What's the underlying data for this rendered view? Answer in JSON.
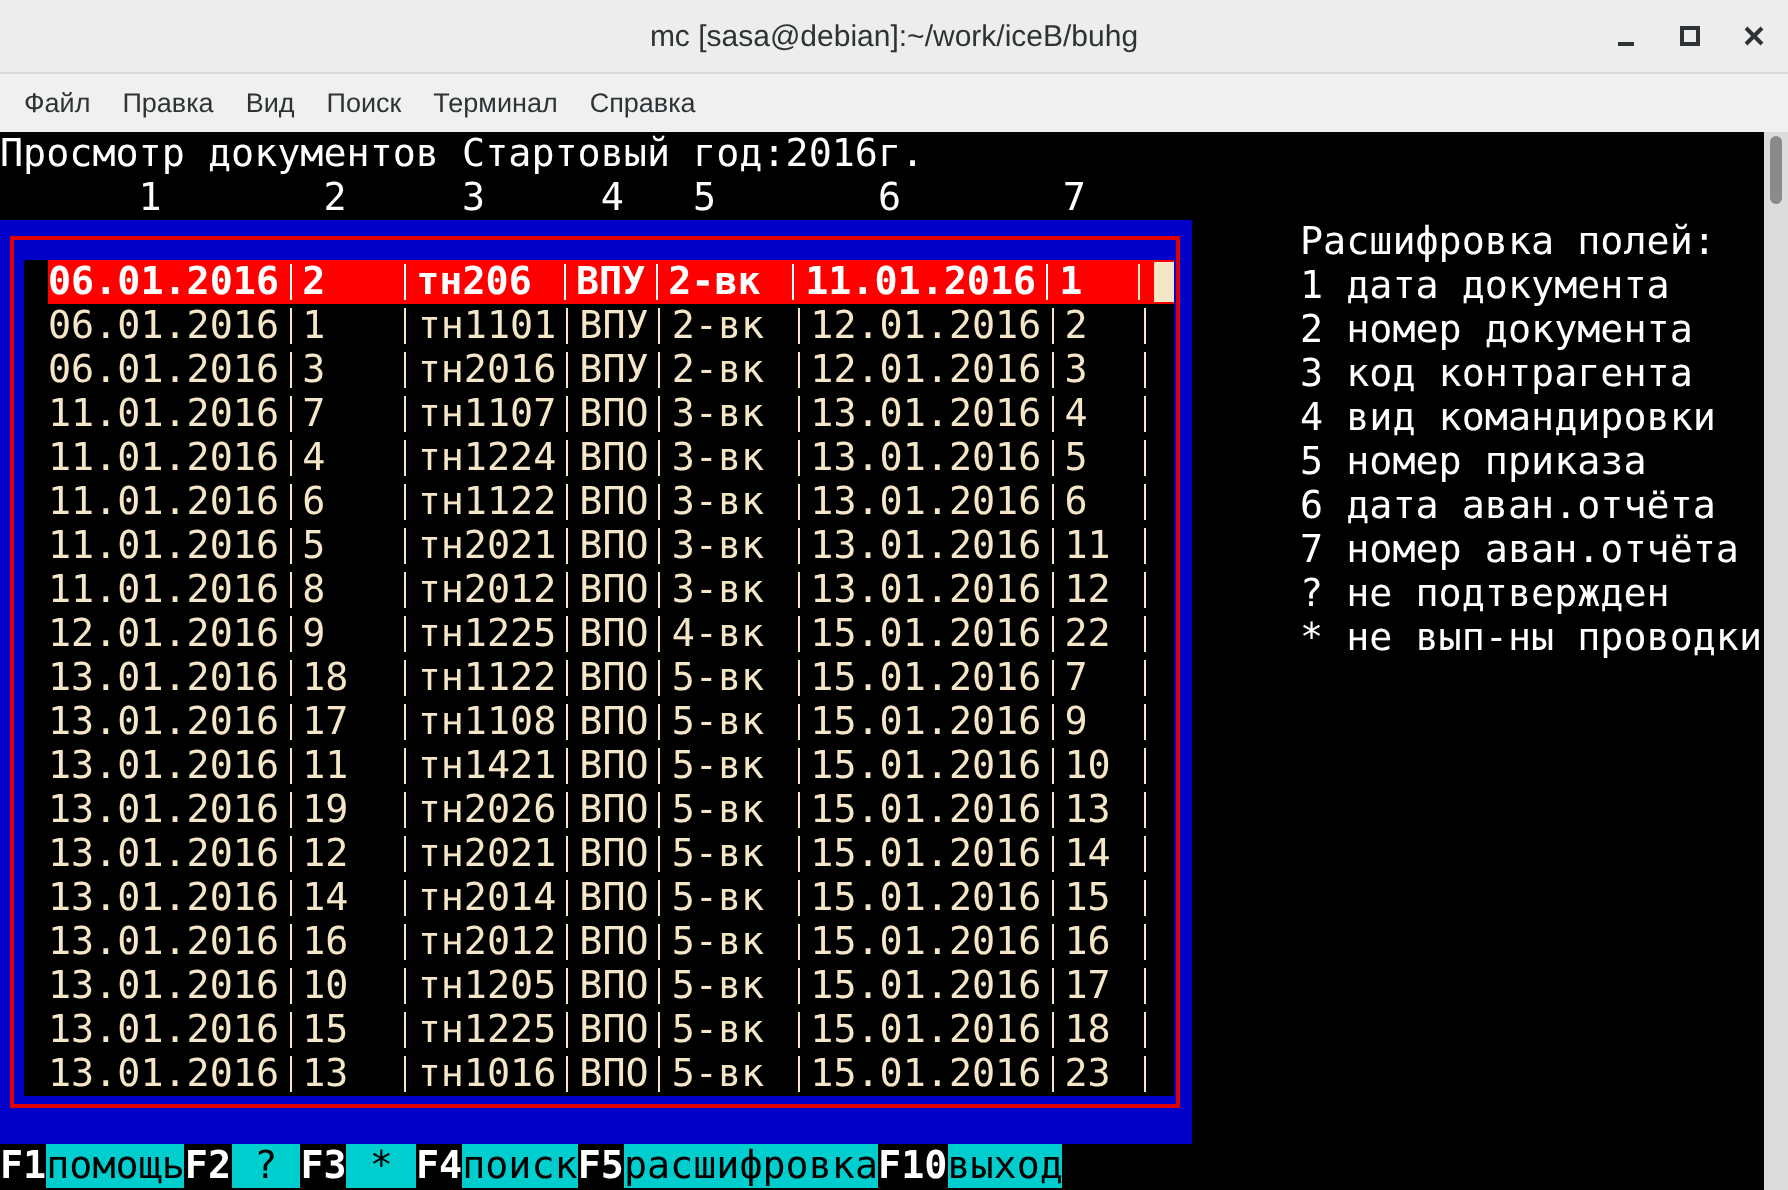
{
  "window": {
    "title": "mc [sasa@debian]:~/work/iceB/buhg"
  },
  "menu": [
    "Файл",
    "Правка",
    "Вид",
    "Поиск",
    "Терминал",
    "Справка"
  ],
  "terminal": {
    "heading": "Просмотр документов Стартовый год:2016г.",
    "column_numbers": "      1       2     3     4   5       6       7",
    "rows": [
      {
        "date": "06.01.2016",
        "number": "2",
        "code": "тн206",
        "kind": "ВПУ",
        "order": "2-вк",
        "report_date": "11.01.2016",
        "report_number": "1",
        "selected": true
      },
      {
        "date": "06.01.2016",
        "number": "1",
        "code": "тн1101",
        "kind": "ВПУ",
        "order": "2-вк",
        "report_date": "12.01.2016",
        "report_number": "2",
        "selected": false
      },
      {
        "date": "06.01.2016",
        "number": "3",
        "code": "тн2016",
        "kind": "ВПУ",
        "order": "2-вк",
        "report_date": "12.01.2016",
        "report_number": "3",
        "selected": false
      },
      {
        "date": "11.01.2016",
        "number": "7",
        "code": "тн1107",
        "kind": "ВПО",
        "order": "3-вк",
        "report_date": "13.01.2016",
        "report_number": "4",
        "selected": false
      },
      {
        "date": "11.01.2016",
        "number": "4",
        "code": "тн1224",
        "kind": "ВПО",
        "order": "3-вк",
        "report_date": "13.01.2016",
        "report_number": "5",
        "selected": false
      },
      {
        "date": "11.01.2016",
        "number": "6",
        "code": "тн1122",
        "kind": "ВПО",
        "order": "3-вк",
        "report_date": "13.01.2016",
        "report_number": "6",
        "selected": false
      },
      {
        "date": "11.01.2016",
        "number": "5",
        "code": "тн2021",
        "kind": "ВПО",
        "order": "3-вк",
        "report_date": "13.01.2016",
        "report_number": "11",
        "selected": false
      },
      {
        "date": "11.01.2016",
        "number": "8",
        "code": "тн2012",
        "kind": "ВПО",
        "order": "3-вк",
        "report_date": "13.01.2016",
        "report_number": "12",
        "selected": false
      },
      {
        "date": "12.01.2016",
        "number": "9",
        "code": "тн1225",
        "kind": "ВПО",
        "order": "4-вк",
        "report_date": "15.01.2016",
        "report_number": "22",
        "selected": false
      },
      {
        "date": "13.01.2016",
        "number": "18",
        "code": "тн1122",
        "kind": "ВПО",
        "order": "5-вк",
        "report_date": "15.01.2016",
        "report_number": "7",
        "selected": false
      },
      {
        "date": "13.01.2016",
        "number": "17",
        "code": "тн1108",
        "kind": "ВПО",
        "order": "5-вк",
        "report_date": "15.01.2016",
        "report_number": "9",
        "selected": false
      },
      {
        "date": "13.01.2016",
        "number": "11",
        "code": "тн1421",
        "kind": "ВПО",
        "order": "5-вк",
        "report_date": "15.01.2016",
        "report_number": "10",
        "selected": false
      },
      {
        "date": "13.01.2016",
        "number": "19",
        "code": "тн2026",
        "kind": "ВПО",
        "order": "5-вк",
        "report_date": "15.01.2016",
        "report_number": "13",
        "selected": false
      },
      {
        "date": "13.01.2016",
        "number": "12",
        "code": "тн2021",
        "kind": "ВПО",
        "order": "5-вк",
        "report_date": "15.01.2016",
        "report_number": "14",
        "selected": false
      },
      {
        "date": "13.01.2016",
        "number": "14",
        "code": "тн2014",
        "kind": "ВПО",
        "order": "5-вк",
        "report_date": "15.01.2016",
        "report_number": "15",
        "selected": false
      },
      {
        "date": "13.01.2016",
        "number": "16",
        "code": "тн2012",
        "kind": "ВПО",
        "order": "5-вк",
        "report_date": "15.01.2016",
        "report_number": "16",
        "selected": false
      },
      {
        "date": "13.01.2016",
        "number": "10",
        "code": "тн1205",
        "kind": "ВПО",
        "order": "5-вк",
        "report_date": "15.01.2016",
        "report_number": "17",
        "selected": false
      },
      {
        "date": "13.01.2016",
        "number": "15",
        "code": "тн1225",
        "kind": "ВПО",
        "order": "5-вк",
        "report_date": "15.01.2016",
        "report_number": "18",
        "selected": false
      },
      {
        "date": "13.01.2016",
        "number": "13",
        "code": "тн1016",
        "kind": "ВПО",
        "order": "5-вк",
        "report_date": "15.01.2016",
        "report_number": "23",
        "selected": false
      }
    ],
    "legend": [
      "Расшифровка полей:",
      "1 дата документа",
      "2 номер документа",
      "3 код контрагента",
      "4 вид командировки",
      "5 номер приказа",
      "6 дата аван.отчёта",
      "7 номер аван.отчёта",
      "? не подтвержден",
      "* не вып-ны проводки"
    ],
    "keys": [
      {
        "key": "F1",
        "label": "помощь"
      },
      {
        "key": "F2",
        "label": "?"
      },
      {
        "key": "F3",
        "label": "*"
      },
      {
        "key": "F4",
        "label": "поиск"
      },
      {
        "key": "F5",
        "label": "расшифровка"
      },
      {
        "key": "F10",
        "label": "выход"
      }
    ]
  }
}
